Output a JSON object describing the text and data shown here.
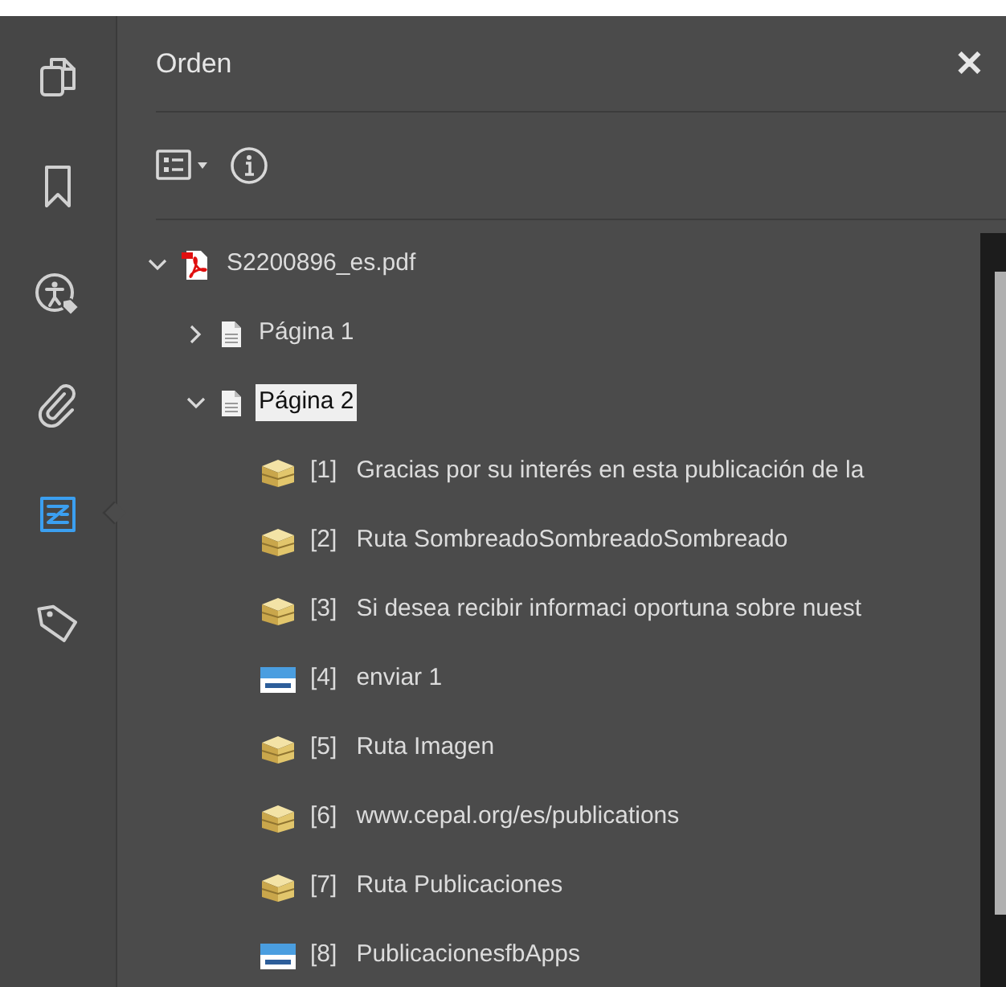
{
  "sidebar": {
    "items": [
      {
        "kind": "pages",
        "selected": false
      },
      {
        "kind": "bookmark",
        "selected": false
      },
      {
        "kind": "accessibility",
        "selected": false
      },
      {
        "kind": "attachment",
        "selected": false
      },
      {
        "kind": "order",
        "selected": true
      },
      {
        "kind": "tags",
        "selected": false
      }
    ]
  },
  "panel": {
    "title": "Orden",
    "close": "✕"
  },
  "tree": [
    {
      "kind": "pdf",
      "label": "S2200896_es.pdf",
      "expanded": true,
      "selected": false,
      "children": [
        {
          "kind": "page",
          "label": "Página 1",
          "expanded": false,
          "selected": false
        },
        {
          "kind": "page",
          "label": "Página 2",
          "expanded": true,
          "selected": true,
          "children": [
            {
              "kind": "tag",
              "index": "[1]",
              "label": "Gracias por su interés en esta publicación de la"
            },
            {
              "kind": "tag",
              "index": "[2]",
              "label": "Ruta SombreadoSombreadoSombreado"
            },
            {
              "kind": "tag",
              "index": "[3]",
              "label": "Si desea recibir informaci oportuna sobre nuest"
            },
            {
              "kind": "form",
              "index": "[4]",
              "label": "enviar 1"
            },
            {
              "kind": "tag",
              "index": "[5]",
              "label": "Ruta Imagen"
            },
            {
              "kind": "tag",
              "index": "[6]",
              "label": "www.cepal.org/es/publications"
            },
            {
              "kind": "tag",
              "index": "[7]",
              "label": "Ruta Publicaciones"
            },
            {
              "kind": "form",
              "index": "[8]",
              "label": "PublicacionesfbApps"
            }
          ]
        }
      ]
    }
  ]
}
